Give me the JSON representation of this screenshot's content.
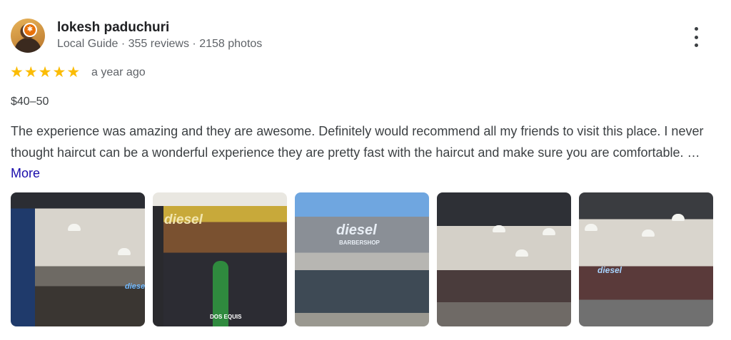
{
  "reviewer": {
    "name": "lokesh paduchuri",
    "meta": "Local Guide · 355 reviews · 2158 photos",
    "badge_icon": "local-guide-star-icon"
  },
  "review": {
    "rating": 5,
    "rating_max": 5,
    "stars": [
      "★",
      "★",
      "★",
      "★",
      "★"
    ],
    "date": "a year ago",
    "price": "$40–50",
    "text": "The experience was amazing and they are awesome. Definitely would recommend all my friends to visit this place. I never thought haircut can be a wonderful experience they are pretty fast with the haircut and make sure you are comfortable. …",
    "more_label": "More"
  },
  "photos": {
    "count": 5,
    "signs": [
      "diesel",
      "diesel",
      "diesel",
      "",
      "diesel"
    ],
    "storefront_sub": "BARBERSHOP",
    "bottle_label": "DOS EQUIS"
  },
  "colors": {
    "star": "#fbbc04",
    "link": "#1a0dab",
    "meta": "#5f6368",
    "badge": "#e8710a"
  }
}
